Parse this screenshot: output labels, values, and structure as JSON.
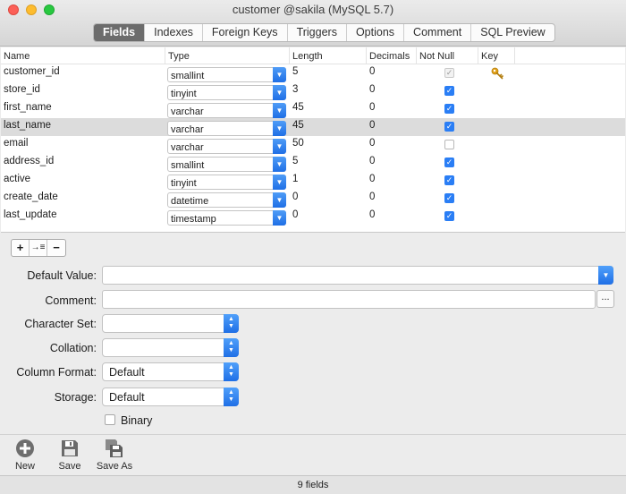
{
  "window": {
    "title": "customer @sakila (MySQL 5.7)"
  },
  "tabs": [
    "Fields",
    "Indexes",
    "Foreign Keys",
    "Triggers",
    "Options",
    "Comment",
    "SQL Preview"
  ],
  "columns": [
    "Name",
    "Type",
    "Length",
    "Decimals",
    "Not Null",
    "Key"
  ],
  "rows": [
    {
      "name": "customer_id",
      "type": "smallint",
      "length": "5",
      "decimals": "0",
      "not_null": true,
      "disabled": true,
      "key": true
    },
    {
      "name": "store_id",
      "type": "tinyint",
      "length": "3",
      "decimals": "0",
      "not_null": true,
      "disabled": false,
      "key": false
    },
    {
      "name": "first_name",
      "type": "varchar",
      "length": "45",
      "decimals": "0",
      "not_null": true,
      "disabled": false,
      "key": false
    },
    {
      "name": "last_name",
      "type": "varchar",
      "length": "45",
      "decimals": "0",
      "not_null": true,
      "disabled": false,
      "key": false,
      "selected": true
    },
    {
      "name": "email",
      "type": "varchar",
      "length": "50",
      "decimals": "0",
      "not_null": false,
      "disabled": false,
      "key": false
    },
    {
      "name": "address_id",
      "type": "smallint",
      "length": "5",
      "decimals": "0",
      "not_null": true,
      "disabled": false,
      "key": false
    },
    {
      "name": "active",
      "type": "tinyint",
      "length": "1",
      "decimals": "0",
      "not_null": true,
      "disabled": false,
      "key": false
    },
    {
      "name": "create_date",
      "type": "datetime",
      "length": "0",
      "decimals": "0",
      "not_null": true,
      "disabled": false,
      "key": false
    },
    {
      "name": "last_update",
      "type": "timestamp",
      "length": "0",
      "decimals": "0",
      "not_null": true,
      "disabled": false,
      "key": false
    }
  ],
  "row_buttons": {
    "add": "+",
    "insert": "→≡",
    "remove": "−"
  },
  "form": {
    "default_value_label": "Default Value:",
    "default_value": "",
    "comment_label": "Comment:",
    "comment": "",
    "comment_more": "...",
    "charset_label": "Character Set:",
    "charset": "",
    "collation_label": "Collation:",
    "collation": "",
    "column_format_label": "Column Format:",
    "column_format": "Default",
    "storage_label": "Storage:",
    "storage": "Default",
    "binary_label": "Binary",
    "binary": false
  },
  "toolbar": {
    "new": "New",
    "save": "Save",
    "save_as": "Save As"
  },
  "status": "9 fields",
  "colors": {
    "accent": "#2a7ef5",
    "selected_row": "#dcdcdc",
    "active_tab": "#6c6c6c"
  }
}
